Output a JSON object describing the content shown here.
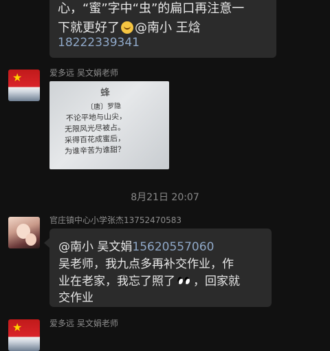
{
  "top_message": {
    "line1": "心，“蜜”字中“虫”的扁口再注意一",
    "line2_pre": "下就更好了",
    "line2_post": "@南小 王焓",
    "line3": "18222339341",
    "emoji": "smile-emoji"
  },
  "msg_photo": {
    "sender": "爱多远  吴文娟老师",
    "poem_title": "蜂",
    "poem_author": "〔唐〕罗隐",
    "poem_lines": [
      "不论平地与山尖，",
      "无限风光尽被占。",
      "采得百花成蜜后，",
      "为谁辛苦为谁甜？"
    ]
  },
  "timestamp": "8月21日 20:07",
  "msg_text": {
    "sender": "官庄镇中心小学张杰13752470583",
    "mention": "@南小  吴文娟",
    "phone": "15620557060",
    "line2": "吴老师，我九点多再补交作业，作",
    "line3_pre": "业在老家，我忘了照了",
    "line3_post": "，回家就",
    "line4": "交作业",
    "emoji": "eyes-emoji"
  },
  "msg_bottom": {
    "sender": "爱多远  吴文娟老师"
  }
}
